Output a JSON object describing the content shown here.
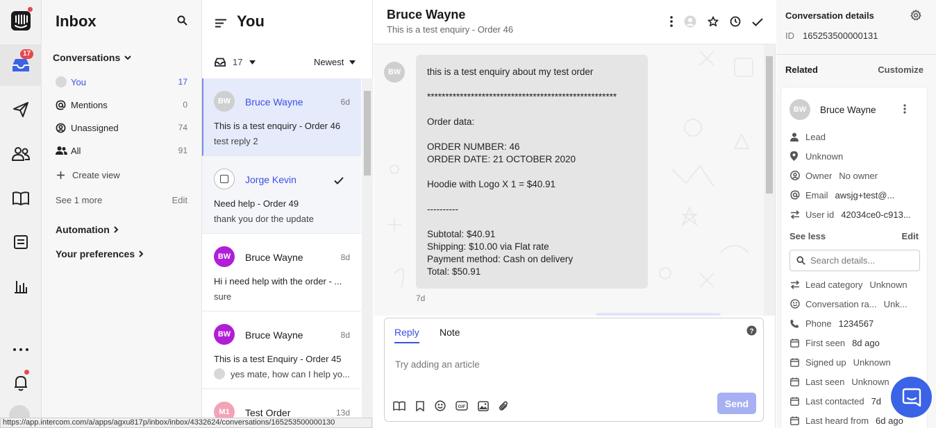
{
  "rail": {
    "inbox_badge": "17",
    "items": [
      "intercom-logo-icon",
      "inbox-icon",
      "outbound-icon",
      "contacts-icon",
      "articles-icon",
      "reports-screen-icon",
      "chart-icon",
      "more-icon",
      "bell-icon"
    ]
  },
  "nav": {
    "title": "Inbox",
    "conversations_label": "Conversations",
    "items": [
      {
        "label": "You",
        "count": "17"
      },
      {
        "label": "Mentions",
        "count": "0"
      },
      {
        "label": "Unassigned",
        "count": "74"
      },
      {
        "label": "All",
        "count": "91"
      }
    ],
    "create_view": "Create view",
    "see_more": "See 1 more",
    "edit": "Edit",
    "automation": "Automation",
    "preferences": "Your preferences"
  },
  "list": {
    "title": "You",
    "filter_count": "17",
    "sort": "Newest",
    "conversations": [
      {
        "initials": "BW",
        "name": "Bruce Wayne",
        "time": "6d",
        "subject": "This is a test enquiry - Order 46",
        "preview": "test reply 2"
      },
      {
        "initials": "",
        "name": "Jorge Kevin",
        "time": "",
        "subject": "Need help - Order 49",
        "preview": "thank you dor the update"
      },
      {
        "initials": "BW",
        "name": "Bruce Wayne",
        "time": "8d",
        "subject": "Hi i need help with the order - ...",
        "preview": "sure"
      },
      {
        "initials": "BW",
        "name": "Bruce Wayne",
        "time": "8d",
        "subject": "This is a test Enquiry - Order 45",
        "preview": "yes mate, how can I help yo..."
      },
      {
        "initials": "M1",
        "name": "Test Order",
        "time": "13d",
        "subject": "",
        "preview": ""
      }
    ]
  },
  "main": {
    "title": "Bruce Wayne",
    "subtitle": "This is a test enquiry - Order 46",
    "sender_initials": "BW",
    "message_lines": [
      "this is a test enquiry about my test order",
      "",
      "****************************************************",
      "",
      "Order data:",
      "",
      "ORDER NUMBER: 46",
      "ORDER DATE: 21 OCTOBER 2020",
      "",
      "Hoodie with Logo X 1 = $40.91",
      "",
      "----------",
      "",
      "Subtotal: $40.91",
      "Shipping: $10.00 via Flat rate",
      "Payment method: Cash on delivery",
      "Total: $50.91"
    ],
    "message_time": "7d",
    "composer": {
      "tab_reply": "Reply",
      "tab_note": "Note",
      "placeholder": "Try adding an article",
      "send": "Send"
    }
  },
  "details": {
    "title": "Conversation details",
    "id_label": "ID",
    "id_value": "165253500000131",
    "related": "Related",
    "customize": "Customize",
    "contact": {
      "initials": "BW",
      "name": "Bruce Wayne",
      "attrs_top": [
        {
          "icon": "person-icon",
          "key": "Lead",
          "value": ""
        },
        {
          "icon": "location-pin-icon",
          "key": "Unknown",
          "value": ""
        },
        {
          "icon": "owner-icon",
          "key": "Owner",
          "value": "No owner"
        },
        {
          "icon": "at-icon",
          "key": "Email",
          "value": "awsjg+test@..."
        },
        {
          "icon": "swap-icon",
          "key": "User id",
          "value": "42034ce0-c913..."
        }
      ],
      "see_less": "See less",
      "edit": "Edit",
      "search_placeholder": "Search details...",
      "attrs_bottom": [
        {
          "icon": "swap-icon",
          "key": "Lead category",
          "value": "Unknown"
        },
        {
          "icon": "smile-icon",
          "key": "Conversation ra...",
          "value": "Unk..."
        },
        {
          "icon": "phone-icon",
          "key": "Phone",
          "value": "1234567"
        },
        {
          "icon": "calendar-icon",
          "key": "First seen",
          "value": "8d ago"
        },
        {
          "icon": "calendar-icon",
          "key": "Signed up",
          "value": "Unknown"
        },
        {
          "icon": "calendar-icon",
          "key": "Last seen",
          "value": "Unknown"
        },
        {
          "icon": "calendar-icon",
          "key": "Last contacted",
          "value": "7d"
        },
        {
          "icon": "calendar-icon",
          "key": "Last heard from",
          "value": "6d ago"
        }
      ]
    }
  },
  "status_url": "https://app.intercom.com/a/apps/agxu817p/inbox/inbox/4332624/conversations/165253500000130",
  "colors": {
    "accent": "#3a4fe6",
    "selected_row": "#e6ebfb",
    "avatar_purple": "#b01ed6",
    "avatar_pink": "#f4a3b6",
    "send_disabled": "#a6b0f3",
    "badge_red": "#e5484d"
  }
}
